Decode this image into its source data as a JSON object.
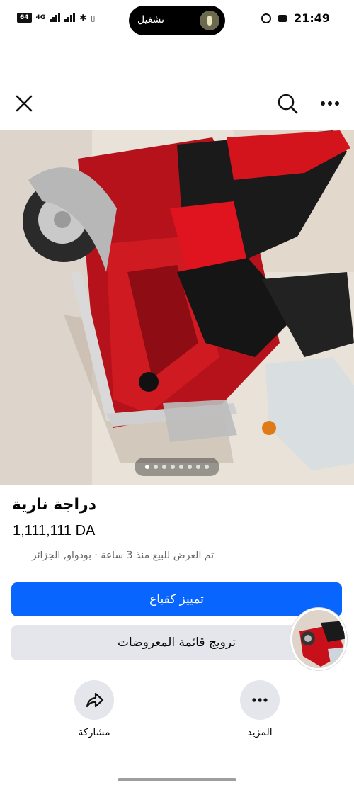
{
  "status_bar": {
    "time": "21:49",
    "battery": "64",
    "network": "4G",
    "pill_text": "تشغيل"
  },
  "listing": {
    "title": "دراجة نارية",
    "price": "1,111,111 DA",
    "meta": "تم العرض للبيع منذ 3 ساعة · بودواو, الجزائر",
    "photo_count": 8,
    "photo_index": 1
  },
  "buttons": {
    "boost_label": "تمييز كقباع",
    "promote_label": "ترويج قائمة المعروضات"
  },
  "actions": {
    "share_label": "مشاركة",
    "more_label": "المزيد"
  },
  "colors": {
    "primary": "#0866ff",
    "secondary": "#e4e6eb",
    "meta_text": "#65676b"
  },
  "icons": {
    "close": "close-icon",
    "search": "search-icon",
    "more": "more-horizontal-icon",
    "share": "share-arrow-icon",
    "more_action": "more-dots-icon"
  }
}
